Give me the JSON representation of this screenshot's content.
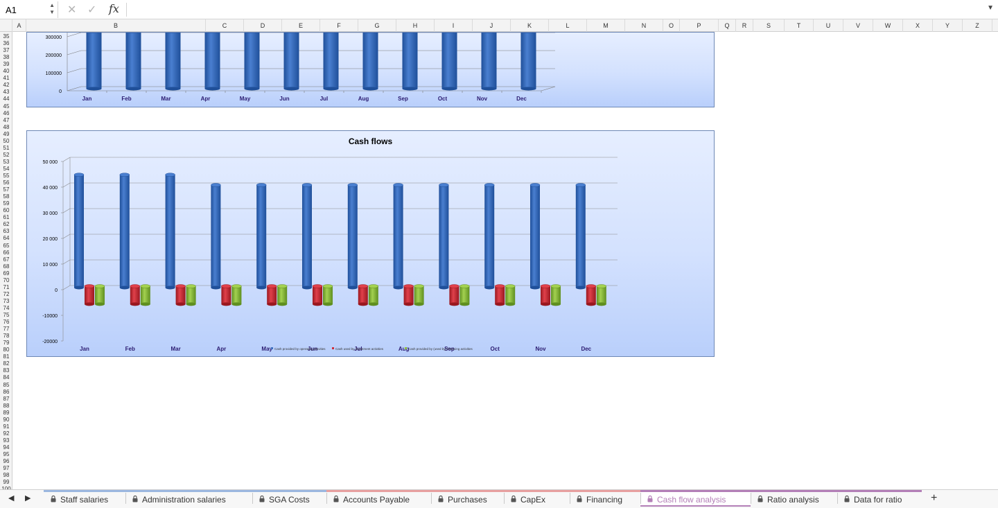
{
  "formula_bar": {
    "cell_ref": "A1",
    "cancel_icon": "close-icon",
    "confirm_icon": "check-icon",
    "fx_label": "fx",
    "formula": ""
  },
  "columns": [
    "A",
    "B",
    "C",
    "D",
    "E",
    "F",
    "G",
    "H",
    "I",
    "J",
    "K",
    "L",
    "M",
    "N",
    "O",
    "P",
    "Q",
    "R",
    "S",
    "T",
    "U",
    "V",
    "W",
    "X",
    "Y",
    "Z"
  ],
  "rows": [
    "35",
    "36",
    "37",
    "38",
    "39",
    "40",
    "41",
    "42",
    "43",
    "44",
    "45",
    "46",
    "47",
    "48",
    "49",
    "50",
    "51",
    "52",
    "53",
    "54",
    "55",
    "56",
    "57",
    "58",
    "59",
    "60",
    "61",
    "62",
    "63",
    "64",
    "65",
    "66",
    "67",
    "68",
    "69",
    "70",
    "71",
    "72",
    "73",
    "74",
    "75",
    "76",
    "77",
    "78",
    "79",
    "80",
    "81",
    "82",
    "83",
    "84",
    "85",
    "86",
    "87",
    "88",
    "89",
    "90",
    "91",
    "92",
    "93",
    "94",
    "95",
    "96",
    "97",
    "98",
    "99",
    "100"
  ],
  "chart_data": [
    {
      "type": "bar",
      "title": "",
      "categories": [
        "Jan",
        "Feb",
        "Mar",
        "Apr",
        "May",
        "Jun",
        "Jul",
        "Aug",
        "Sep",
        "Oct",
        "Nov",
        "Dec"
      ],
      "y_ticks": [
        "300000",
        "200000",
        "100000",
        "0"
      ],
      "series": [
        {
          "values": [
            330000,
            330000,
            330000,
            330000,
            330000,
            330000,
            330000,
            330000,
            330000,
            330000,
            330000,
            330000
          ]
        }
      ],
      "ylim": [
        0,
        300000
      ],
      "color": "#3f6fbf"
    },
    {
      "type": "bar",
      "title": "Cash flows",
      "categories": [
        "Jan",
        "Feb",
        "Mar",
        "Apr",
        "May",
        "Jun",
        "Jul",
        "Aug",
        "Sep",
        "Oct",
        "Nov",
        "Dec"
      ],
      "y_ticks": [
        "50 000",
        "40 000",
        "30 000",
        "20 000",
        "10 000",
        "0",
        "-10000",
        "-20000"
      ],
      "ylim": [
        -20000,
        50000
      ],
      "series": [
        {
          "name": "Cash provided by operating activities",
          "color": "#3f6fbf",
          "values": [
            44000,
            44000,
            44000,
            40000,
            40000,
            40000,
            40000,
            40000,
            40000,
            40000,
            40000,
            40000
          ]
        },
        {
          "name": "Cash used by investment activities",
          "color": "#d0303a",
          "values": [
            -7000,
            -7000,
            -7000,
            -7000,
            -7000,
            -7000,
            -7000,
            -7000,
            -7000,
            -7000,
            -7000,
            -7000
          ]
        },
        {
          "name": "Cash provided by (used by) financing activities",
          "color": "#8fc03f",
          "values": [
            -7000,
            -7000,
            -7000,
            -7000,
            -7000,
            -7000,
            -7000,
            -7000,
            -7000,
            -7000,
            -7000,
            -7000
          ]
        }
      ],
      "legend_position": "bottom",
      "legend": [
        "Cash provided by operating activities",
        "Cash used by investment activities",
        "Cash provided by (used by) financing activities"
      ]
    }
  ],
  "sheet_tabs": [
    {
      "label": "Staff salaries",
      "locked": true,
      "color": "#9bb7e0",
      "active": false
    },
    {
      "label": "Administration salaries",
      "locked": true,
      "color": "#9bb7e0",
      "active": false
    },
    {
      "label": "SGA Costs",
      "locked": true,
      "color": "#9bb7e0",
      "active": false
    },
    {
      "label": "Accounts Payable",
      "locked": true,
      "color": "#e8a0a0",
      "active": false
    },
    {
      "label": "Purchases",
      "locked": true,
      "color": "#e8a0a0",
      "active": false
    },
    {
      "label": "CapEx",
      "locked": true,
      "color": "#e8a0a0",
      "active": false
    },
    {
      "label": "Financing",
      "locked": true,
      "color": "#e8a0a0",
      "active": false
    },
    {
      "label": "Cash flow analysis",
      "locked": true,
      "color": "#b37fb7",
      "active": true
    },
    {
      "label": "Ratio analysis",
      "locked": true,
      "color": "#b37fb7",
      "active": false
    },
    {
      "label": "Data for ratio",
      "locked": true,
      "color": "#b37fb7",
      "active": false
    }
  ],
  "add_sheet_label": "+"
}
